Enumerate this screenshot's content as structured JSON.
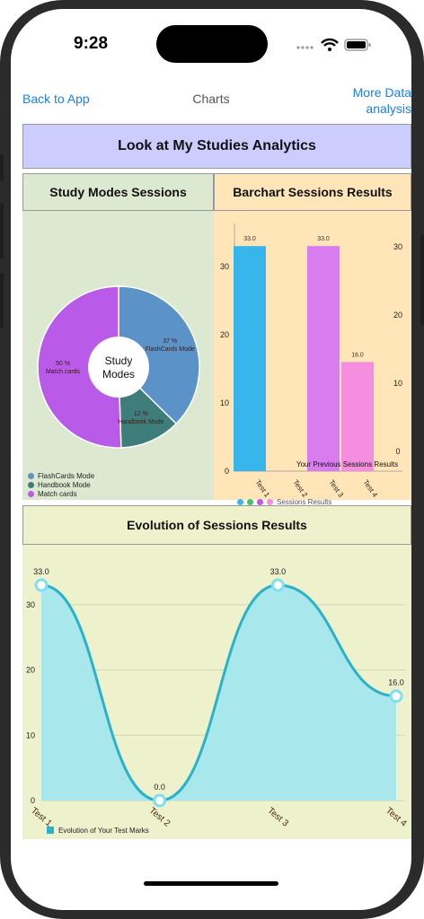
{
  "status": {
    "time": "9:28"
  },
  "nav": {
    "back_label": "Back to App",
    "title": "Charts",
    "more_line1": "More Data",
    "more_line2": "analysis"
  },
  "app_title": "Look at My Studies Analytics",
  "pie_header": "Study Modes Sessions",
  "bar_header": "Barchart Sessions Results",
  "evolution_header": "Evolution of Sessions Results",
  "colors": {
    "flashcards": "#5b93c9",
    "handbook": "#3f7d7a",
    "match": "#b95be8",
    "bar1": "#38b6ec",
    "bar2": "#d97cf0",
    "bar3": "#f58de0",
    "line": "#2ab2c8",
    "area": "#a8e8ec"
  },
  "chart_data": [
    {
      "type": "pie",
      "center_label_line1": "Study",
      "center_label_line2": "Modes",
      "slices": [
        {
          "name": "FlashCards Mode",
          "value": 37,
          "label": "37 %"
        },
        {
          "name": "Handbook Mode",
          "value": 12,
          "label": "12 %"
        },
        {
          "name": "Match cards",
          "value": 50,
          "label": "50 %"
        }
      ],
      "legend": [
        "FlashCards Mode",
        "Handbook Mode",
        "Match cards"
      ]
    },
    {
      "type": "bar",
      "categories": [
        "Test 1",
        "Test 2",
        "Test 3",
        "Test 4"
      ],
      "values": [
        33.0,
        null,
        33.0,
        16.0
      ],
      "value_labels": [
        "33.0",
        "",
        "33.0",
        "16.0"
      ],
      "ylim": [
        0,
        35
      ],
      "yticks_left": [
        "0",
        "10",
        "20",
        "30"
      ],
      "yticks_right": [
        "0",
        "10",
        "20",
        "30"
      ],
      "annotation": "Your Previous Sessions Results",
      "legend": "Sessions Results"
    },
    {
      "type": "area",
      "categories": [
        "Test 1",
        "Test 2",
        "Test 3",
        "Test 4"
      ],
      "values": [
        33.0,
        0.0,
        33.0,
        16.0
      ],
      "value_labels": [
        "33.0",
        "0.0",
        "33.0",
        "16.0"
      ],
      "ylim": [
        0,
        33
      ],
      "yticks": [
        "0",
        "10",
        "20",
        "30"
      ],
      "legend": "Evolution of Your Test Marks"
    }
  ]
}
